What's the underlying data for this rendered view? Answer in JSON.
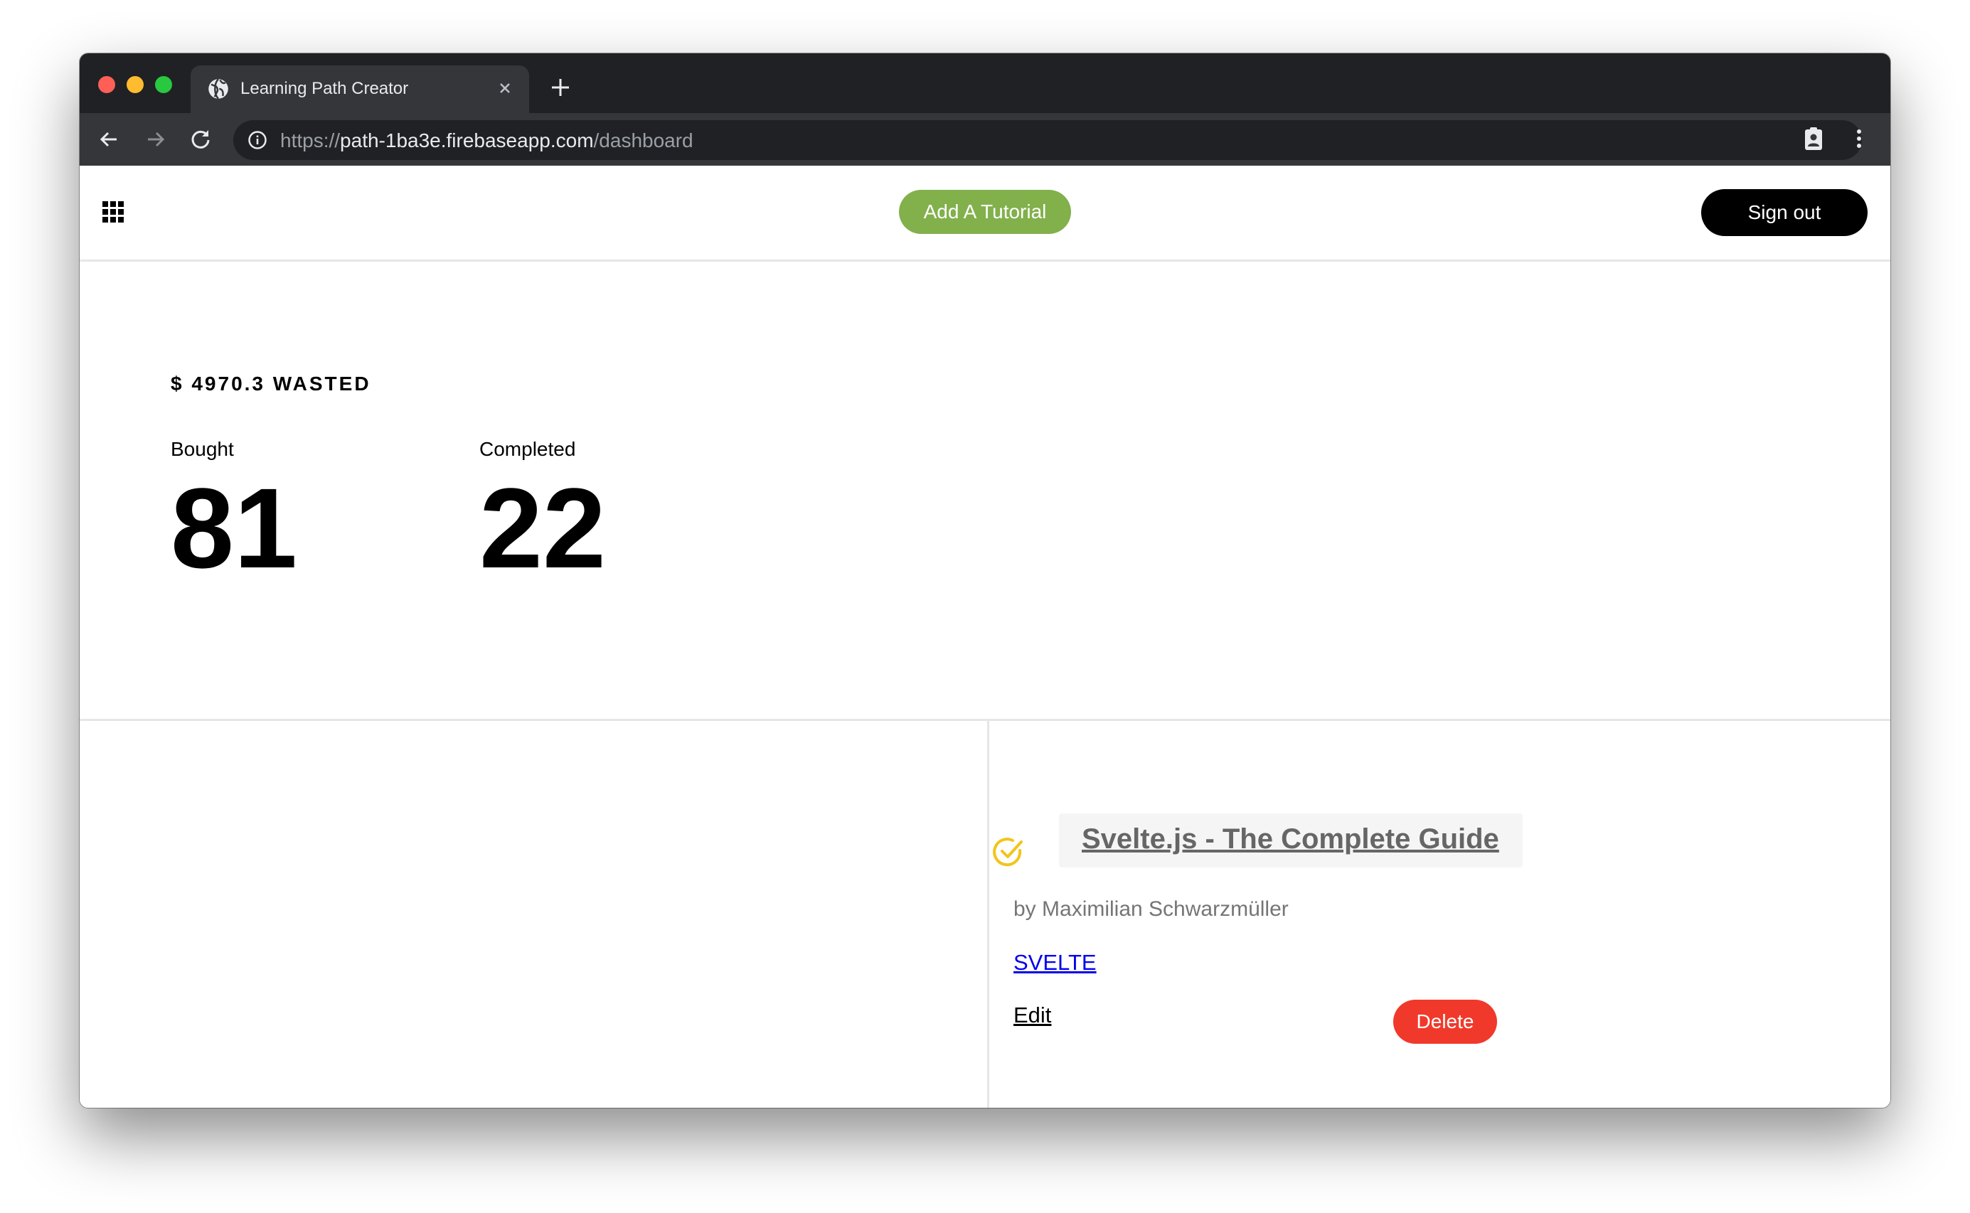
{
  "browser": {
    "tab_title": "Learning Path Creator",
    "url_scheme": "https://",
    "url_host": "path-1ba3e.firebaseapp.com",
    "url_path": "/dashboard"
  },
  "header": {
    "add_label": "Add A Tutorial",
    "signout_label": "Sign out"
  },
  "stats": {
    "wasted_text": "$ 4970.3 WASTED",
    "bought_label": "Bought",
    "bought_value": "81",
    "completed_label": "Completed",
    "completed_value": "22"
  },
  "tutorial": {
    "title": "Svelte.js - The Complete Guide",
    "author": "by Maximilian Schwarzmüller",
    "tag": "SVELTE",
    "edit_label": "Edit",
    "delete_label": "Delete"
  },
  "colors": {
    "add_button": "#82b04b",
    "signout_button": "#000000",
    "delete_button": "#f0392b",
    "check_icon": "#f2c51b",
    "tag_link": "#0000ee"
  },
  "icons": [
    "globe-icon",
    "close-icon",
    "plus-icon",
    "back-arrow-icon",
    "forward-arrow-icon",
    "reload-icon",
    "info-icon",
    "clipboard-account-icon",
    "more-vert-icon",
    "apps-grid-icon",
    "check-circle-icon"
  ]
}
